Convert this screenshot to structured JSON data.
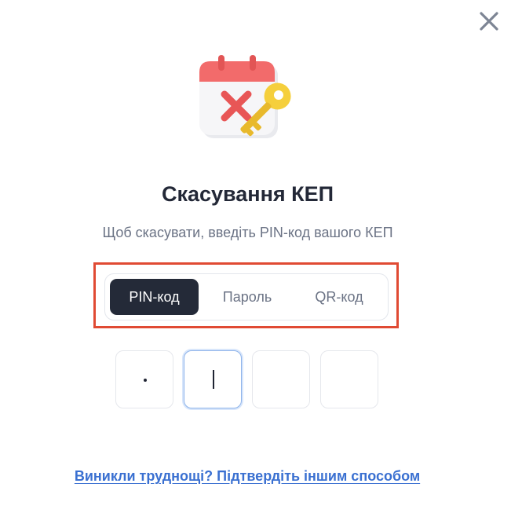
{
  "dialog": {
    "title": "Скасування КЕП",
    "subtitle": "Щоб скасувати, введіть PIN-код вашого КЕП",
    "close_icon": "close-x-icon",
    "illustration_icon": "calendar-cancel-key-icon"
  },
  "tabs": [
    {
      "label": "PIN-код",
      "active": true
    },
    {
      "label": "Пароль",
      "active": false
    },
    {
      "label": "QR-код",
      "active": false
    }
  ],
  "pin": {
    "digits": [
      "•",
      "",
      "",
      ""
    ],
    "focused_index": 1
  },
  "alt_link": {
    "label": "Виникли труднощі? Підтвердіть іншим способом"
  },
  "colors": {
    "active_tab_bg": "#242a38",
    "link": "#3a70d1",
    "highlight": "#e04a33",
    "calendar_red": "#f26b6b",
    "key_yellow": "#f5cf3c"
  }
}
